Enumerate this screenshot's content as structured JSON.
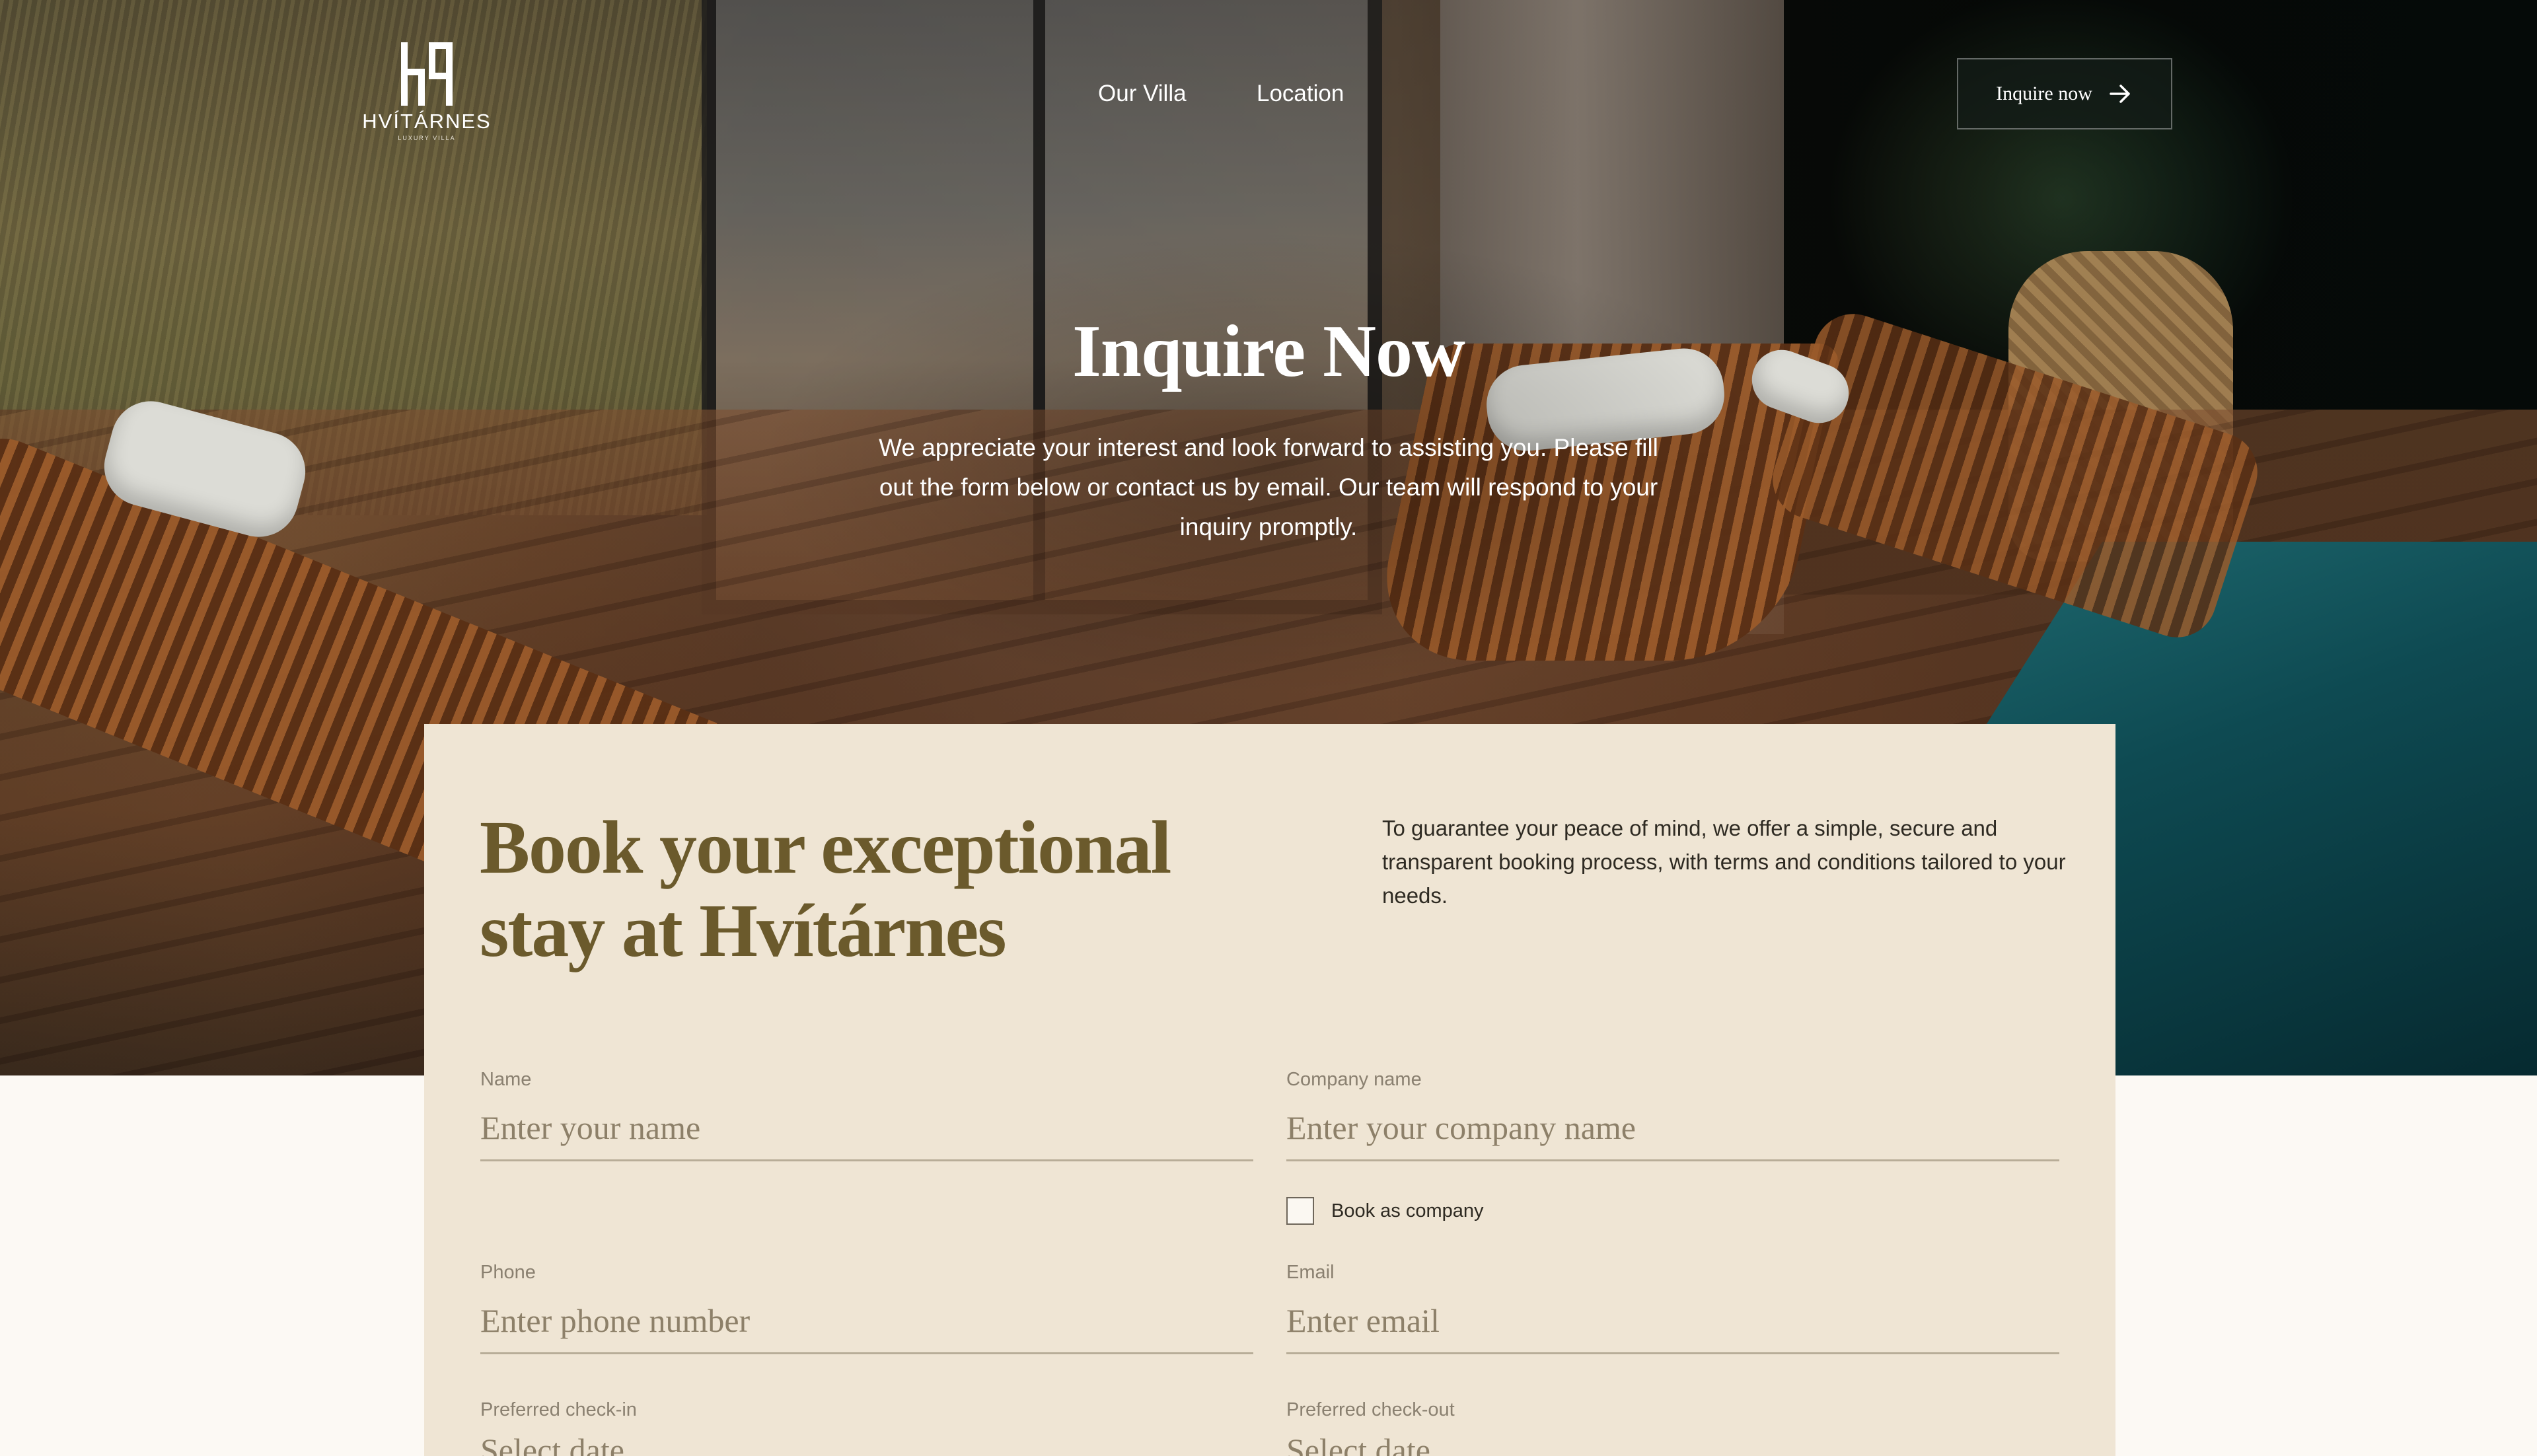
{
  "brand": {
    "name": "HVÍTÁRNES",
    "tagline": "LUXURY VILLA"
  },
  "nav": {
    "links": [
      "Our Villa",
      "Location"
    ],
    "cta_label": "Inquire now"
  },
  "hero": {
    "title": "Inquire Now",
    "subtitle": "We appreciate your interest and look forward to assisting you. Please fill out the form below or contact us by email. Our team will respond to your inquiry promptly."
  },
  "form": {
    "title": "Book your exceptional stay at Hvítárnes",
    "intro": "To guarantee your peace of mind, we offer a simple, secure and transparent booking process, with terms and conditions tailored to your needs.",
    "name": {
      "label": "Name",
      "placeholder": "Enter your name"
    },
    "company": {
      "label": "Company name",
      "placeholder": "Enter your company name"
    },
    "book_as_company": "Book as company",
    "phone": {
      "label": "Phone",
      "placeholder": "Enter phone number"
    },
    "email": {
      "label": "Email",
      "placeholder": "Enter email"
    },
    "checkin": {
      "label": "Preferred check-in",
      "placeholder": "Select date"
    },
    "checkout": {
      "label": "Preferred check-out",
      "placeholder": "Select date"
    }
  },
  "colors": {
    "card_bg": "#efe5d4",
    "title_olive": "#6b5a2c",
    "page_bg": "#fcf9f4"
  },
  "icons": {
    "cta": "arrow-right-icon"
  }
}
